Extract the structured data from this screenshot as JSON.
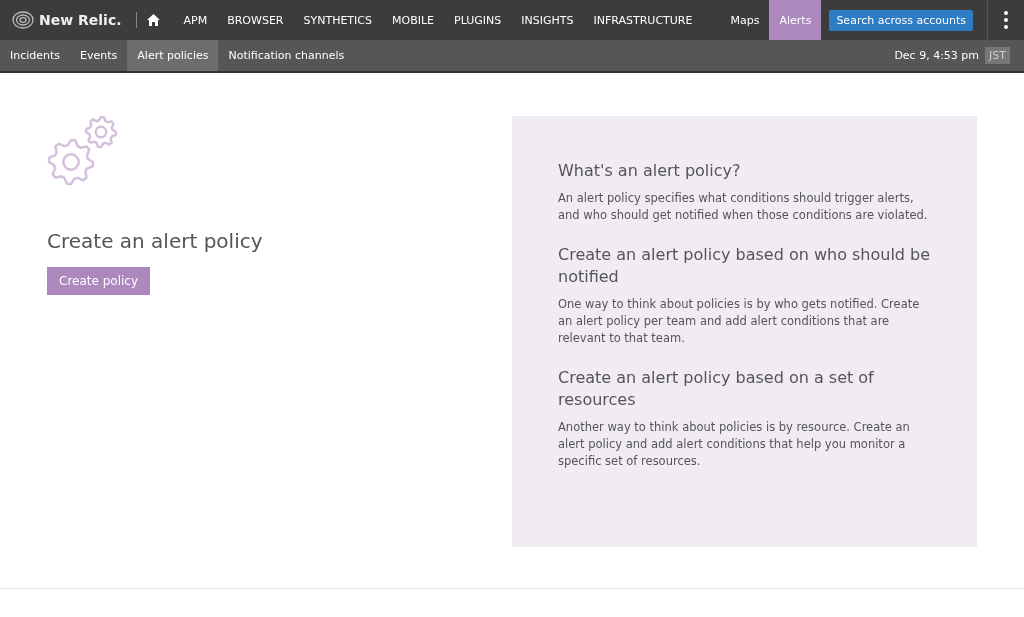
{
  "brand": {
    "name": "New Relic."
  },
  "nav": [
    {
      "label": "APM",
      "selected": false
    },
    {
      "label": "BROWSER",
      "selected": false
    },
    {
      "label": "SYNTHETICS",
      "selected": false
    },
    {
      "label": "MOBILE",
      "selected": false
    },
    {
      "label": "PLUGINS",
      "selected": false
    },
    {
      "label": "INSIGHTS",
      "selected": false
    },
    {
      "label": "INFRASTRUCTURE",
      "selected": false
    }
  ],
  "nav_right": [
    {
      "label": "Maps",
      "selected": false
    },
    {
      "label": "Alerts",
      "selected": true
    }
  ],
  "search_button": "Search across accounts",
  "subnav": [
    {
      "label": "Incidents",
      "selected": false
    },
    {
      "label": "Events",
      "selected": false
    },
    {
      "label": "Alert policies",
      "selected": true
    },
    {
      "label": "Notification channels",
      "selected": false
    }
  ],
  "datetime": "Dec 9, 4:53 pm",
  "timezone": "JST",
  "main": {
    "heading": "Create an alert policy",
    "button": "Create policy"
  },
  "info": [
    {
      "heading": "What's an alert policy?",
      "text": "An alert policy specifies what conditions should trigger alerts, and who should get notified when those conditions are violated."
    },
    {
      "heading": "Create an alert policy based on who should be notified",
      "text": "One way to think about policies is by who gets notified. Create an alert policy per team and add alert conditions that are relevant to that team."
    },
    {
      "heading": "Create an alert policy based on a set of resources",
      "text": "Another way to think about policies is by resource. Create an alert policy and add alert conditions that help you monitor a specific set of resources."
    }
  ]
}
